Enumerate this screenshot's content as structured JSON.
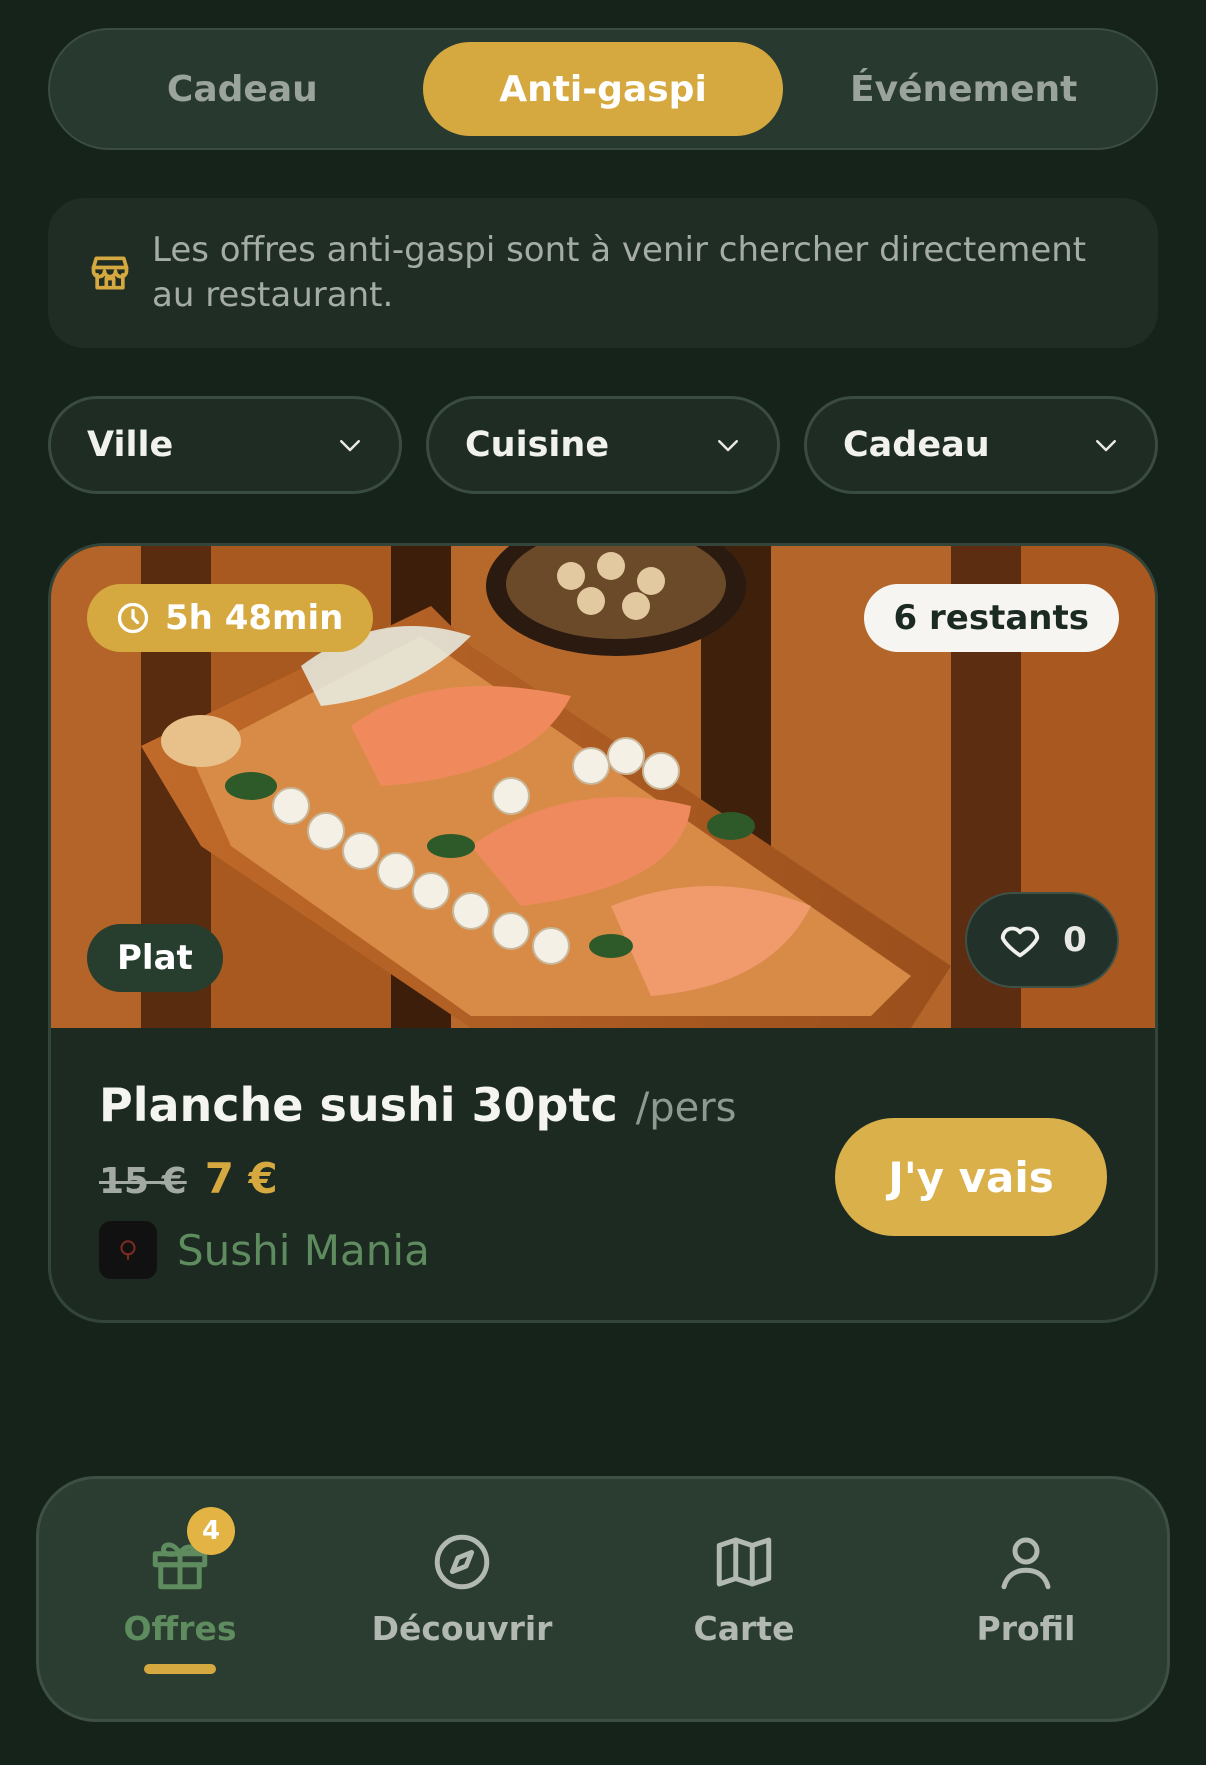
{
  "tabs": [
    {
      "label": "Cadeau",
      "active": false
    },
    {
      "label": "Anti-gaspi",
      "active": true
    },
    {
      "label": "Événement",
      "active": false
    }
  ],
  "info": {
    "icon": "store-icon",
    "text": "Les offres anti-gaspi sont à venir chercher directement au restaurant."
  },
  "filters": [
    {
      "label": "Ville"
    },
    {
      "label": "Cuisine"
    },
    {
      "label": "Cadeau"
    }
  ],
  "offer": {
    "timer": "5h 48min",
    "remaining": "6 restants",
    "category": "Plat",
    "likes": "0",
    "title": "Planche sushi 30ptc",
    "unit": "/pers",
    "old_price": "15 €",
    "new_price": "7 €",
    "restaurant": "Sushi Mania",
    "cta": "J'y vais"
  },
  "nav": {
    "items": [
      {
        "label": "Offres",
        "icon": "gift-icon",
        "active": true,
        "badge": "4"
      },
      {
        "label": "Découvrir",
        "icon": "compass-icon",
        "active": false
      },
      {
        "label": "Carte",
        "icon": "map-icon",
        "active": false
      },
      {
        "label": "Profil",
        "icon": "user-icon",
        "active": false
      }
    ]
  },
  "colors": {
    "background": "#15231b",
    "accent": "#d5a93f",
    "green_text": "#5f8c5f"
  }
}
